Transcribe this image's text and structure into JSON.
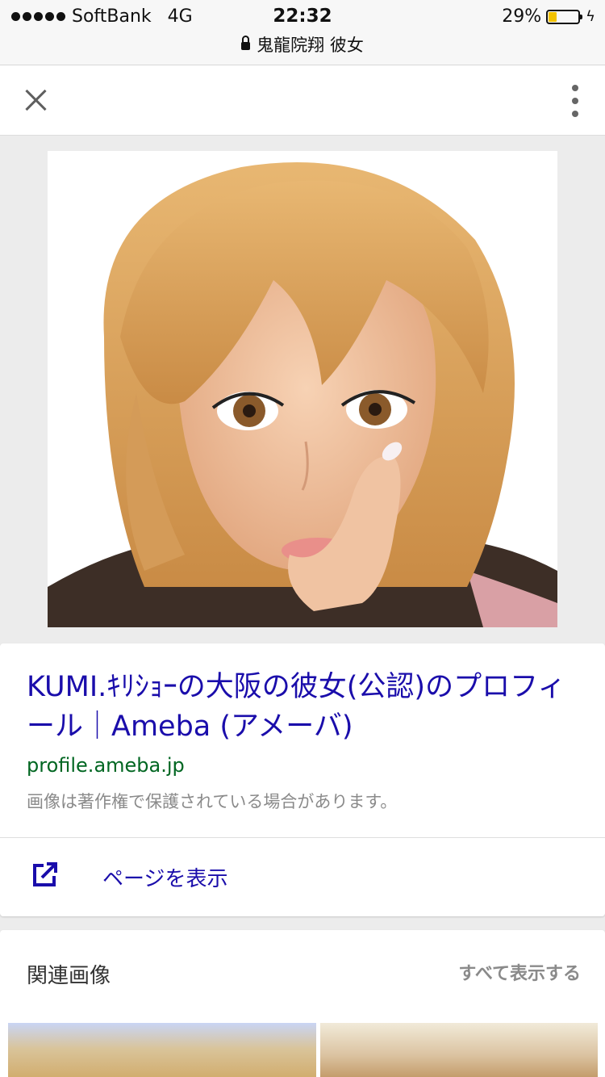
{
  "status_bar": {
    "carrier": "SoftBank",
    "network": "4G",
    "time": "22:32",
    "battery_percent": "29%",
    "battery_level": 0.29,
    "url": "鬼龍院翔 彼女"
  },
  "toolbar": {
    "close_icon": "close-icon",
    "more_icon": "more-vertical-icon"
  },
  "result": {
    "title": "KUMI.ｷﾘｼｮｰの大阪の彼女(公認)のプロフィール｜Ameba (アメーバ)",
    "domain": "profile.ameba.jp",
    "copyright_note": "画像は著作権で保護されている場合があります。",
    "visit_label": "ページを表示"
  },
  "related": {
    "title": "関連画像",
    "show_all": "すべて表示する"
  },
  "colors": {
    "link": "#1a0dab",
    "domain": "#006621",
    "muted": "#8a8a8a",
    "battery": "#f2c200"
  }
}
